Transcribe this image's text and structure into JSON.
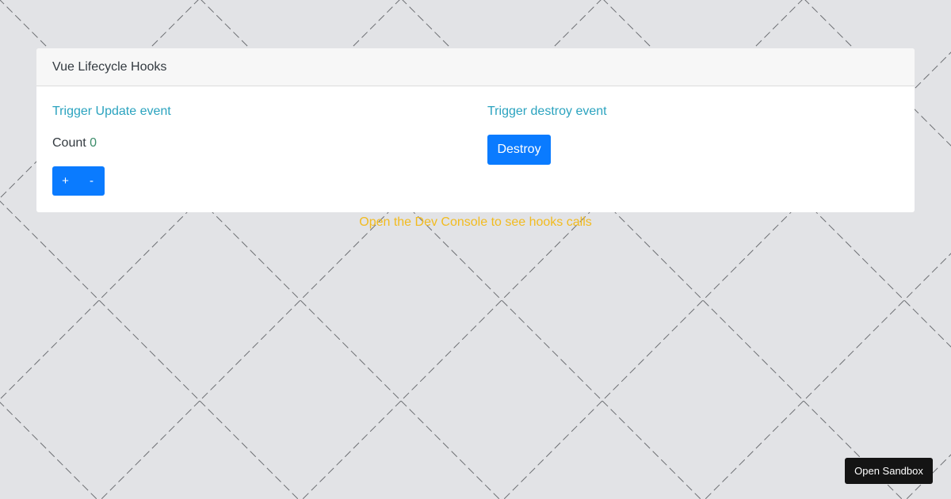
{
  "card": {
    "title": "Vue Lifecycle Hooks"
  },
  "update_section": {
    "title": "Trigger Update event",
    "count_label": "Count",
    "count_value": "0",
    "plus_label": "+",
    "minus_label": "-"
  },
  "destroy_section": {
    "title": "Trigger destroy event",
    "destroy_label": "Destroy"
  },
  "hint": "Open the Dev Console to see hooks calls",
  "sandbox_button": "Open Sandbox",
  "colors": {
    "background": "#e2e3e6",
    "primary_button": "#0a7bff",
    "link_text": "#2ba3bf",
    "count_value": "#3c8c6a",
    "hint_text": "#f2bb1f",
    "sandbox_button": "#141414"
  }
}
